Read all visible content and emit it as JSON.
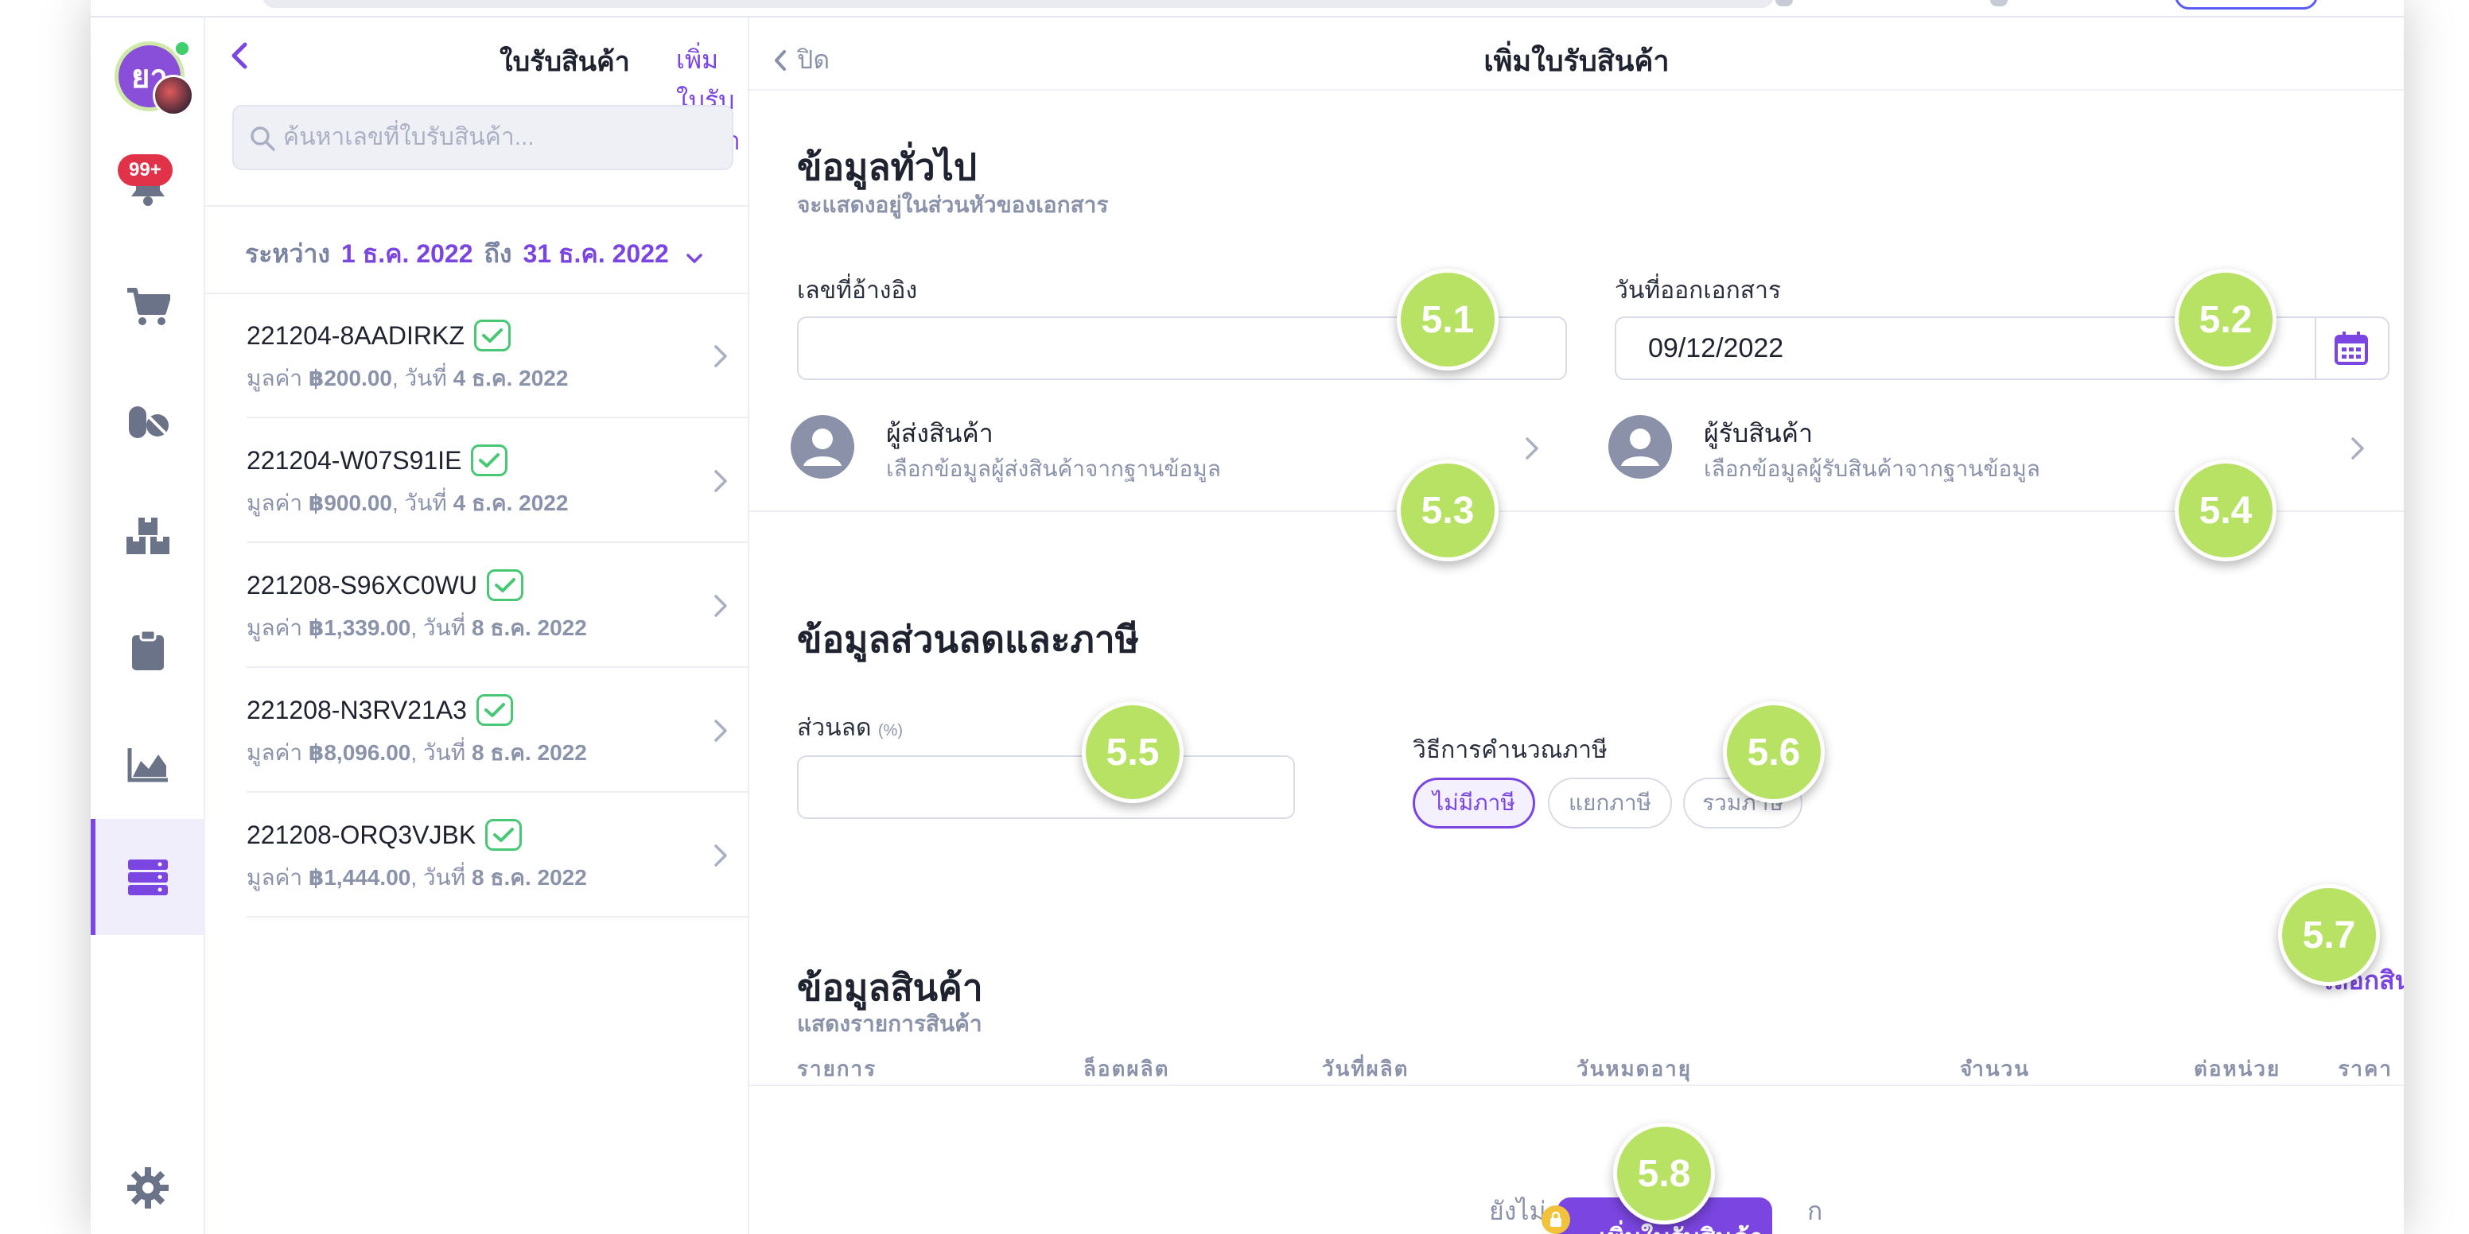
{
  "rail": {
    "avatar_initials": "ยา",
    "notification_badge": "99+",
    "icons": [
      "bell-icon",
      "cart-icon",
      "pills-icon",
      "boxes-icon",
      "clipboard-icon",
      "chart-icon",
      "server-icon",
      "gear-icon"
    ]
  },
  "list_panel": {
    "title": "ใบรับสินค้า",
    "add_link": "เพิ่มใบรับสินค้า",
    "search_placeholder": "ค้นหาเลขที่ใบรับสินค้า...",
    "range": {
      "label": "ระหว่าง",
      "from": "1 ธ.ค. 2022",
      "to_word": "ถึง",
      "to": "31 ธ.ค. 2022"
    },
    "items": [
      {
        "code": "221204-8AADIRKZ",
        "meta_prefix": "มูลค่า ",
        "amount": "฿200.00",
        "meta_mid": ", วันที่ ",
        "date": "4 ธ.ค. 2022"
      },
      {
        "code": "221204-W07S91IE",
        "meta_prefix": "มูลค่า ",
        "amount": "฿900.00",
        "meta_mid": ", วันที่ ",
        "date": "4 ธ.ค. 2022"
      },
      {
        "code": "221208-S96XC0WU",
        "meta_prefix": "มูลค่า ",
        "amount": "฿1,339.00",
        "meta_mid": ", วันที่ ",
        "date": "8 ธ.ค. 2022"
      },
      {
        "code": "221208-N3RV21A3",
        "meta_prefix": "มูลค่า ",
        "amount": "฿8,096.00",
        "meta_mid": ", วันที่ ",
        "date": "8 ธ.ค. 2022"
      },
      {
        "code": "221208-ORQ3VJBK",
        "meta_prefix": "มูลค่า ",
        "amount": "฿1,444.00",
        "meta_mid": ", วันที่ ",
        "date": "8 ธ.ค. 2022"
      }
    ]
  },
  "detail": {
    "close_label": "ปิด",
    "title": "เพิ่มใบรับสินค้า",
    "general": {
      "title": "ข้อมูลทั่วไป",
      "subtitle": "จะแสดงอยู่ในส่วนหัวของเอกสาร",
      "ref_label": "เลขที่อ้างอิง",
      "ref_value": "",
      "date_label": "วันที่ออกเอกสาร",
      "date_value": "09/12/2022",
      "sender_title": "ผู้ส่งสินค้า",
      "sender_sub": "เลือกข้อมูลผู้ส่งสินค้าจากฐานข้อมูล",
      "receiver_title": "ผู้รับสินค้า",
      "receiver_sub": "เลือกข้อมูลผู้รับสินค้าจากฐานข้อมูล"
    },
    "discount_tax": {
      "title": "ข้อมูลส่วนลดและภาษี",
      "discount_label": "ส่วนลด",
      "discount_unit": "(%)",
      "discount_value": "",
      "tax_method_label": "วิธีการคำนวณภาษี",
      "tax_options": [
        "ไม่มีภาษี",
        "แยกภาษี",
        "รวมภาษี"
      ],
      "tax_selected": "ไม่มีภาษี"
    },
    "products": {
      "title": "ข้อมูลสินค้า",
      "subtitle": "แสดงรายการสินค้า",
      "choose_link": "เลือกสินค้า",
      "columns": [
        "รายการ",
        "ล็อตผลิต",
        "วันที่ผลิต",
        "วันหมดอายุ",
        "จำนวน",
        "ต่อหน่วย",
        "ราคา"
      ],
      "empty_text_1": "ยังไม่",
      "empty_text_1b": "ก",
      "add_button": "เพิ่มใบรับสินค้า"
    }
  },
  "markers": [
    "5.1",
    "5.2",
    "5.3",
    "5.4",
    "5.5",
    "5.6",
    "5.7",
    "5.8"
  ],
  "colors": {
    "accent": "#7a45e0",
    "marker": "#b8e264",
    "success": "#48c774",
    "badge": "#e0334a",
    "muted_text": "#8b93ab"
  }
}
